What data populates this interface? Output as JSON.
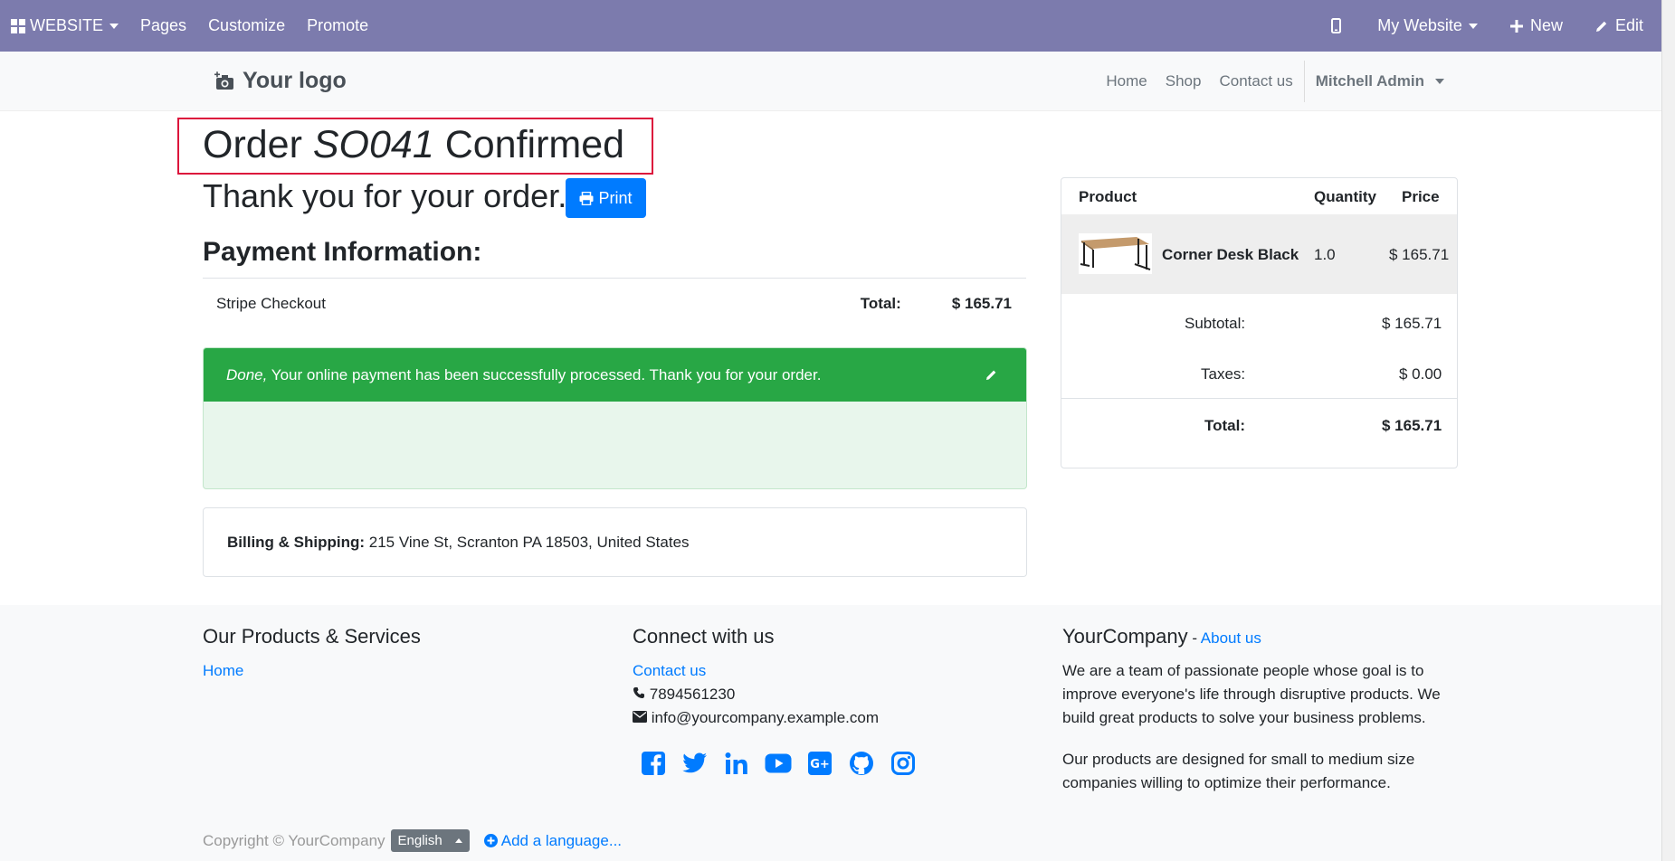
{
  "adminbar": {
    "website_label": "WEBSITE",
    "pages_label": "Pages",
    "customize_label": "Customize",
    "promote_label": "Promote",
    "site_selector": "My Website",
    "new_label": "New",
    "edit_label": "Edit"
  },
  "header": {
    "logo_text": "Your logo",
    "nav": [
      "Home",
      "Shop",
      "Contact us"
    ],
    "user": "Mitchell Admin"
  },
  "order": {
    "title_prefix": "Order",
    "order_ref": "SO041",
    "title_suffix": "Confirmed",
    "thanks": "Thank you for your order.",
    "print_label": "Print",
    "payment_heading": "Payment Information:",
    "payment_method": "Stripe Checkout",
    "total_label": "Total:",
    "total_value": "$ 165.71",
    "alert_status": "Done,",
    "alert_message": " Your online payment has been successfully processed. Thank you for your order.",
    "billing_label": "Billing & Shipping:",
    "billing_address": " 215 Vine St, Scranton PA 18503, United States"
  },
  "summary": {
    "headers": {
      "product": "Product",
      "quantity": "Quantity",
      "price": "Price"
    },
    "item": {
      "name": "Corner Desk Black",
      "quantity": "1.0",
      "price": "$ 165.71"
    },
    "subtotal_label": "Subtotal:",
    "subtotal_value": "$ 165.71",
    "taxes_label": "Taxes:",
    "taxes_value": "$ 0.00",
    "total_label": "Total:",
    "total_value": "$ 165.71"
  },
  "footer": {
    "col1_title": "Our Products & Services",
    "col1_link": "Home",
    "col2_title": "Connect with us",
    "col2_link": "Contact us",
    "phone": "7894561230",
    "email": "info@yourcompany.example.com",
    "col3_title": "YourCompany",
    "col3_sep": " - ",
    "col3_link": "About us",
    "para1": "We are a team of passionate people whose goal is to improve everyone's life through disruptive products. We build great products to solve your business problems.",
    "para2": "Our products are designed for small to medium size companies willing to optimize their performance.",
    "copyright": "Copyright © YourCompany",
    "language": "English",
    "add_language": "Add a language..."
  },
  "colors": {
    "adminbar": "#7c7bad",
    "primary": "#007bff",
    "success": "#28a745",
    "highlight_border": "#dc143c"
  }
}
